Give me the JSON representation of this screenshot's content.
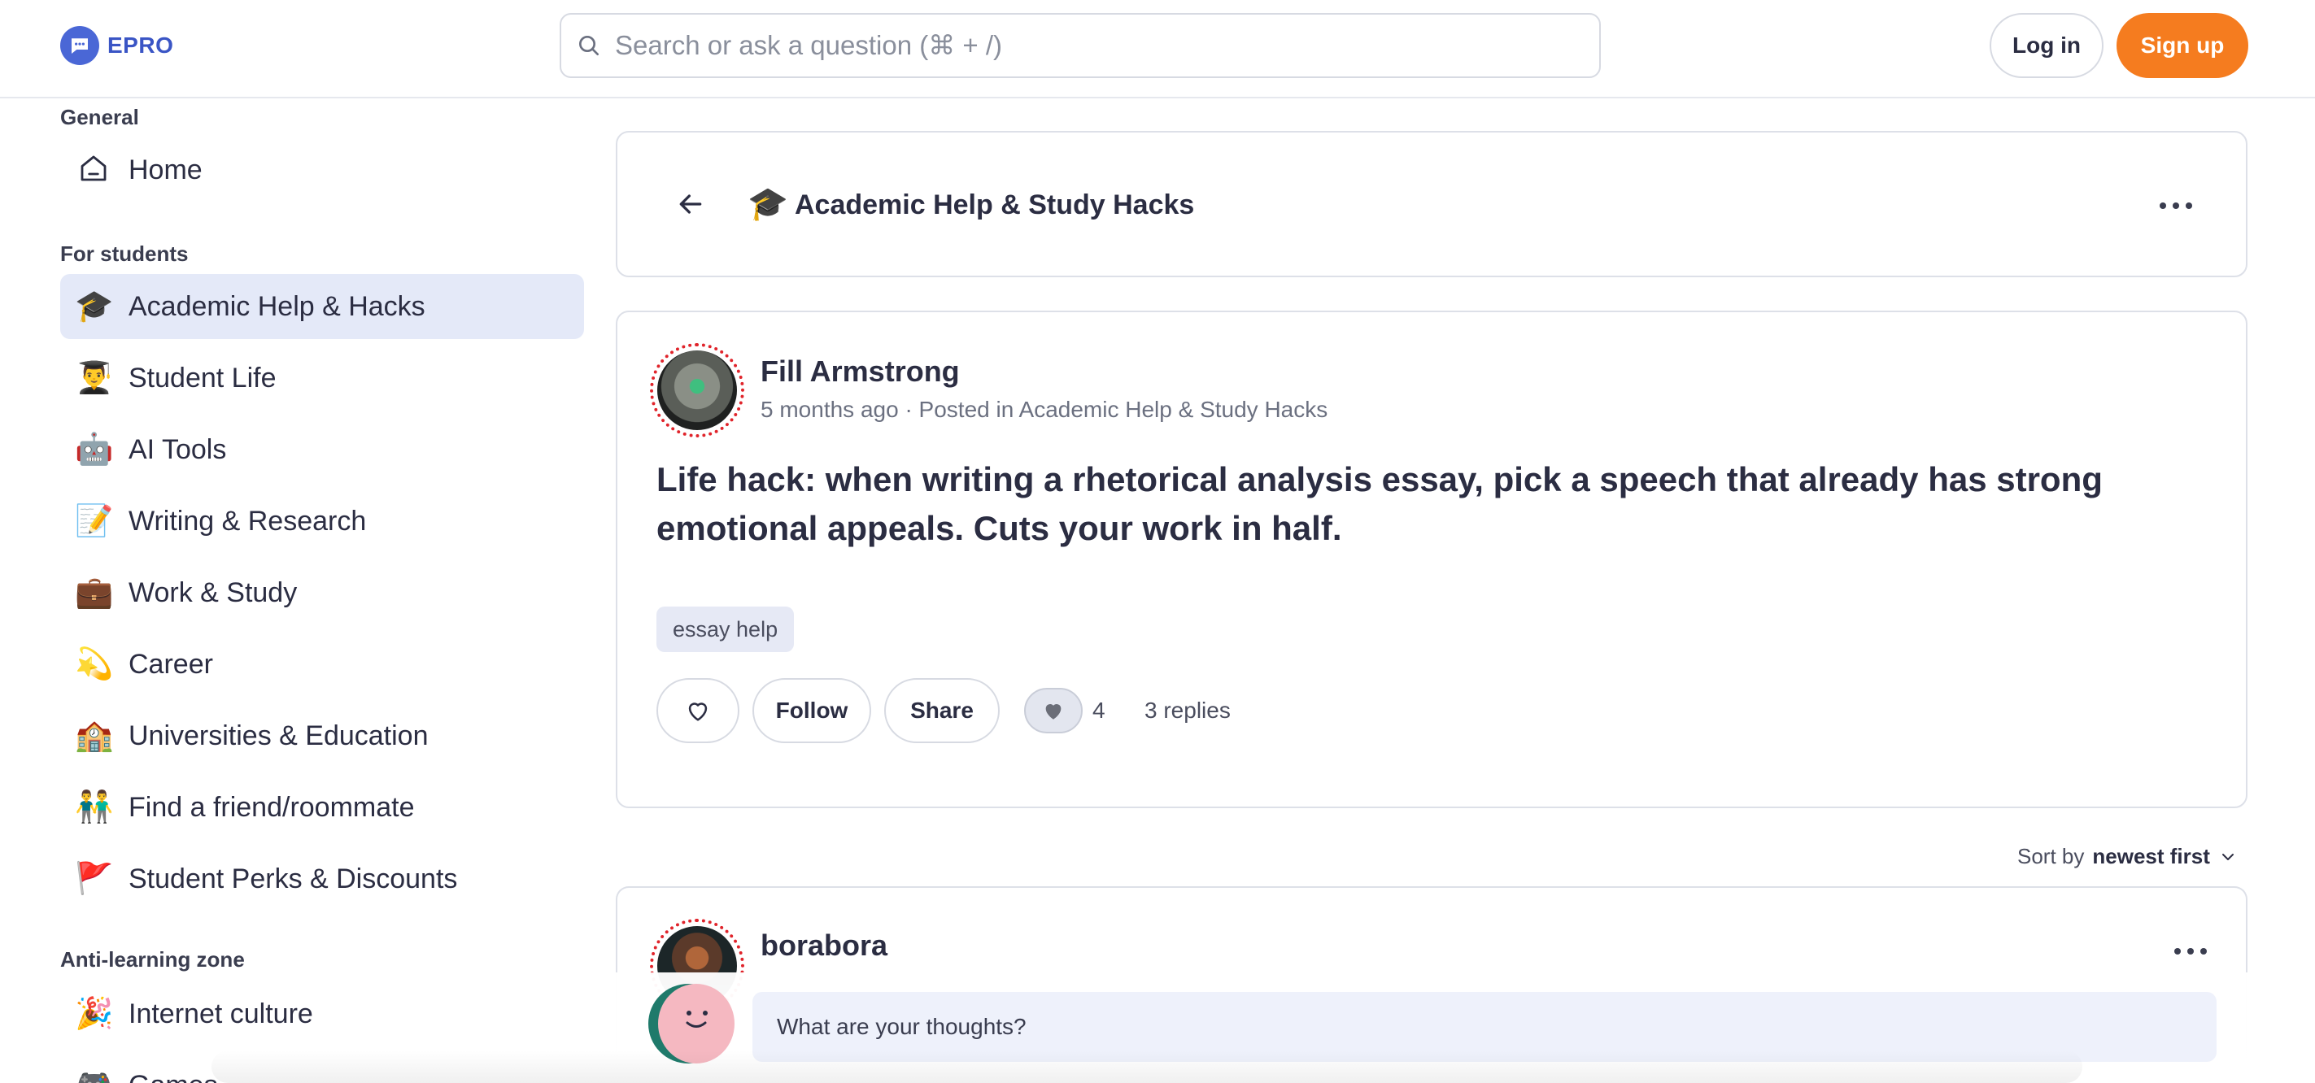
{
  "app": {
    "name": "EPRO",
    "accent": "#f57c1f",
    "brand": "#3a55c5"
  },
  "header": {
    "search_placeholder": "Search or ask a question (⌘ + /)",
    "login_label": "Log in",
    "signup_label": "Sign up"
  },
  "sidebar": {
    "sections": [
      {
        "title": "General",
        "items": [
          {
            "icon": "home-icon",
            "label": "Home"
          }
        ]
      },
      {
        "title": "For students",
        "items": [
          {
            "icon": "🎓",
            "label": "Academic Help & Hacks",
            "active": true
          },
          {
            "icon": "👨‍🎓",
            "label": "Student Life"
          },
          {
            "icon": "🤖",
            "label": "AI Tools"
          },
          {
            "icon": "📝",
            "label": "Writing & Research"
          },
          {
            "icon": "💼",
            "label": "Work & Study"
          },
          {
            "icon": "💫",
            "label": "Career"
          },
          {
            "icon": "🏫",
            "label": "Universities & Education"
          },
          {
            "icon": "👬",
            "label": "Find a friend/roommate"
          },
          {
            "icon": "🚩",
            "label": "Student Perks & Discounts"
          }
        ]
      },
      {
        "title": "Anti-learning zone",
        "items": [
          {
            "icon": "🎉",
            "label": "Internet culture"
          },
          {
            "icon": "🎮",
            "label": "Games"
          }
        ]
      }
    ]
  },
  "topic": {
    "emoji": "🎓",
    "title": "Academic Help & Study Hacks"
  },
  "post": {
    "author": "Fill Armstrong",
    "meta": "5 months ago · Posted in Academic Help & Study Hacks",
    "text": "Life hack: when writing a rhetorical analysis essay, pick a speech that already has strong emotional appeals. Cuts your work in half.",
    "tag": "essay help",
    "follow_label": "Follow",
    "share_label": "Share",
    "likes": "4",
    "replies": "3 replies"
  },
  "sort": {
    "prefix": "Sort by",
    "value": "newest first"
  },
  "reply": {
    "author": "borabora"
  },
  "composer": {
    "placeholder": "What are your thoughts?"
  }
}
